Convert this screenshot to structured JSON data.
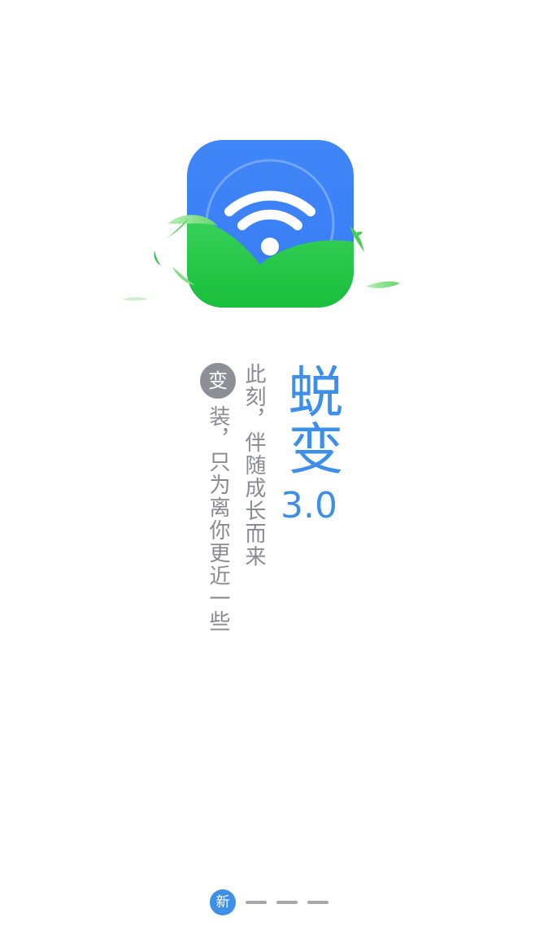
{
  "app": {
    "logo": "wifi-shield-logo",
    "brand_colors": {
      "blue": "#3d8fe8",
      "icon_blue_top": "#3f82f7",
      "icon_blue_bottom": "#3e7ff5",
      "leaf_green": "#1cc13e",
      "leaf_light": "#7ee27a"
    }
  },
  "intro": {
    "title": "蜕变",
    "version": "3.0",
    "line1": "此刻，伴随成长而来",
    "badge": "变",
    "line2": "装，只为离你更近一些"
  },
  "pager": {
    "active_label": "新",
    "current": 1,
    "total": 4
  }
}
